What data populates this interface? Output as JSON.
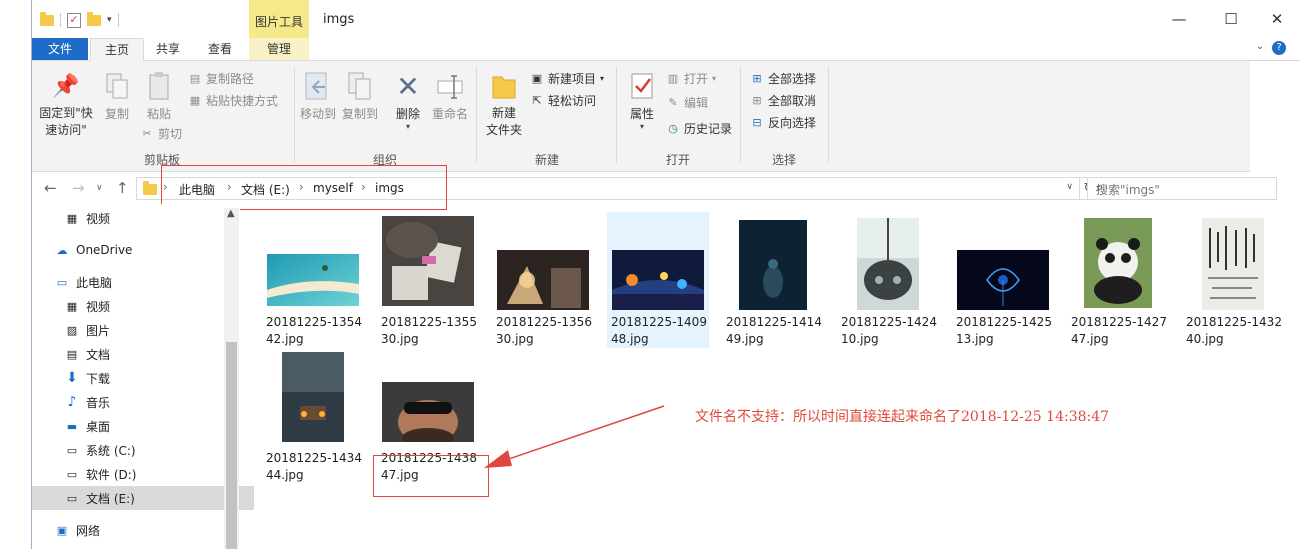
{
  "window": {
    "title": "imgs",
    "context_tab": "图片工具",
    "controls": {
      "minimize": "—",
      "maximize": "☐",
      "close": "✕"
    }
  },
  "ribbon_tabs": [
    "文件",
    "主页",
    "共享",
    "查看",
    "管理"
  ],
  "ribbon": {
    "clipboard": {
      "label": "剪贴板",
      "pin": "固定到\"快\n速访问\"",
      "copy": "复制",
      "paste": "粘贴",
      "copy_path": "复制路径",
      "paste_shortcut": "粘贴快捷方式",
      "cut": "剪切"
    },
    "organize": {
      "label": "组织",
      "move_to": "移动到",
      "copy_to": "复制到",
      "delete": "删除",
      "rename": "重命名"
    },
    "new": {
      "label": "新建",
      "new_folder": "新建\n文件夹",
      "new_item": "新建项目",
      "easy_access": "轻松访问"
    },
    "open": {
      "label": "打开",
      "properties": "属性",
      "open": "打开",
      "edit": "编辑",
      "history": "历史记录"
    },
    "select": {
      "label": "选择",
      "select_all": "全部选择",
      "select_none": "全部取消",
      "invert": "反向选择"
    }
  },
  "address": {
    "crumbs": [
      "此电脑",
      "文档 (E:)",
      "myself",
      "imgs"
    ],
    "search_placeholder": "搜索\"imgs\""
  },
  "nav_pane": [
    {
      "label": "视频",
      "icon": "video-icon"
    },
    {
      "label": "OneDrive",
      "icon": "cloud-icon"
    },
    {
      "label": "此电脑",
      "icon": "computer-icon"
    },
    {
      "label": "视频",
      "icon": "video-icon"
    },
    {
      "label": "图片",
      "icon": "pictures-icon"
    },
    {
      "label": "文档",
      "icon": "documents-icon"
    },
    {
      "label": "下载",
      "icon": "download-icon"
    },
    {
      "label": "音乐",
      "icon": "music-icon"
    },
    {
      "label": "桌面",
      "icon": "desktop-icon"
    },
    {
      "label": "系统 (C:)",
      "icon": "drive-icon"
    },
    {
      "label": "软件 (D:)",
      "icon": "drive-icon"
    },
    {
      "label": "文档 (E:)",
      "icon": "drive-icon"
    },
    {
      "label": "网络",
      "icon": "network-icon"
    }
  ],
  "files": [
    {
      "name": "20181225-135442.jpg"
    },
    {
      "name": "20181225-135530.jpg"
    },
    {
      "name": "20181225-135630.jpg"
    },
    {
      "name": "20181225-140948.jpg"
    },
    {
      "name": "20181225-141449.jpg"
    },
    {
      "name": "20181225-142410.jpg"
    },
    {
      "name": "20181225-142513.jpg"
    },
    {
      "name": "20181225-142747.jpg"
    },
    {
      "name": "20181225-143240.jpg"
    },
    {
      "name": "20181225-143444.jpg"
    },
    {
      "name": "20181225-143847.jpg"
    }
  ],
  "annotation": "文件名不支持：所以时间直接连起来命名了2018-12-25 14:38:47",
  "colors": {
    "accent": "#1e6cc8",
    "annotation": "#e0453f",
    "selection": "#e5f3ff"
  }
}
